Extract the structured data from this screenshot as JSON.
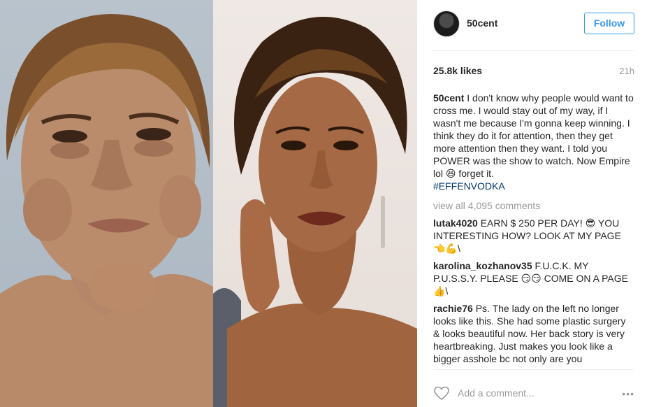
{
  "post": {
    "username": "50cent",
    "follow_label": "Follow",
    "likes": "25.8k likes",
    "time": "21h",
    "caption": {
      "username": "50cent",
      "text": "I don't know why people would want to cross me. I would stay out of my way, if I wasn't me because I'm gonna keep winning. I think they do it for attention, then they get more attention then they want. I told you POWER was the show to watch. Now Empire lol 😆 forget it.",
      "hashtag": "#EFFENVODKA"
    },
    "view_all": "view all 4,095 comments",
    "comments": [
      {
        "username": "lutak4020",
        "text": "EARN $ 250 PER DAY! 😎 YOU INTERESTING HOW? LOOK AT MY PAGE 👈💪\\"
      },
      {
        "username": "karolina_kozhanov35",
        "text": "F.U.C.K. MY P.U.S.S.Y. PLEASE 😏😏 COME ON A PAGE👍\\"
      },
      {
        "username": "rachie76",
        "text": "Ps. The lady on the left no longer looks like this. She had some plastic surgery & looks beautiful now. Her back story is very heartbreaking. Just makes you look like a bigger asshole bc not only are you disrespecting the timeless beauty"
      }
    ],
    "add_comment_placeholder": "Add a comment...",
    "more_label": "•••"
  },
  "colors": {
    "accent": "#3897f0",
    "hashtag": "#003569",
    "muted": "#999999",
    "text": "#262626"
  },
  "icons": {
    "like": "heart-outline-icon",
    "options": "more-options-icon"
  }
}
